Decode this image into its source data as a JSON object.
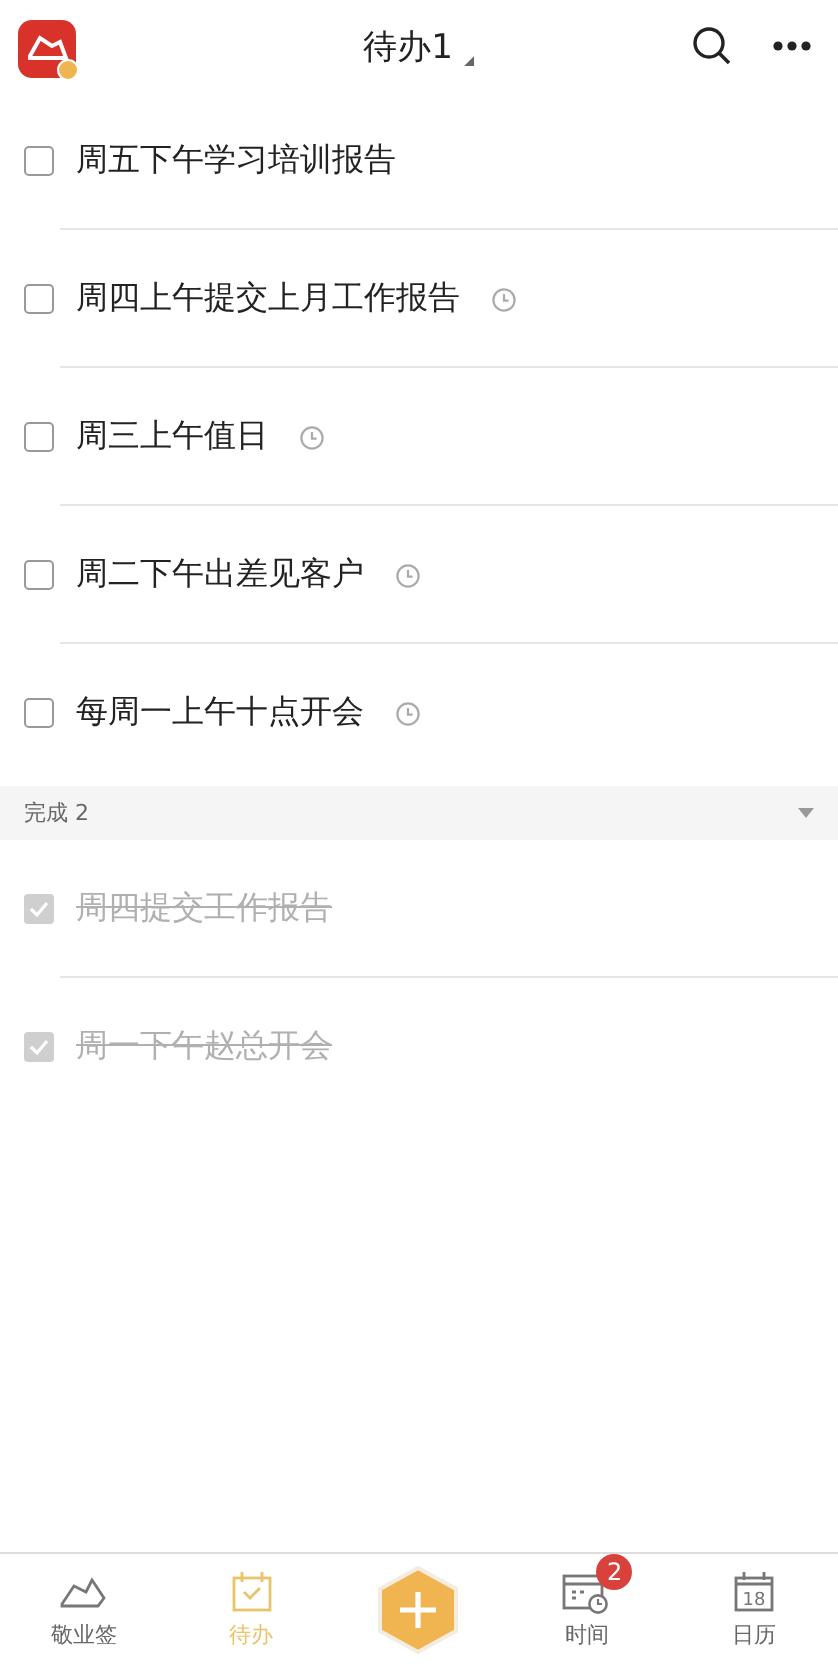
{
  "header": {
    "title": "待办1"
  },
  "tasks": [
    {
      "text": "周五下午学习培训报告",
      "done": false,
      "reminder": false
    },
    {
      "text": "周四上午提交上月工作报告",
      "done": false,
      "reminder": true
    },
    {
      "text": "周三上午值日",
      "done": false,
      "reminder": true
    },
    {
      "text": "周二下午出差见客户",
      "done": false,
      "reminder": true
    },
    {
      "text": "每周一上午十点开会",
      "done": false,
      "reminder": true
    }
  ],
  "completed_section": {
    "label": "完成",
    "count": "2",
    "expanded": true
  },
  "completed": [
    {
      "text": "周四提交工作报告",
      "done": true,
      "reminder": false
    },
    {
      "text": "周一下午赵总开会",
      "done": true,
      "reminder": false
    }
  ],
  "tabs": [
    {
      "kind": "notes",
      "label": "敬业签",
      "selected": false
    },
    {
      "kind": "todo",
      "label": "待办",
      "selected": true
    },
    {
      "kind": "add",
      "selected": false
    },
    {
      "kind": "time",
      "label": "时间",
      "selected": false,
      "badge": "2"
    },
    {
      "kind": "calendar",
      "label": "日历",
      "selected": false,
      "icon_text": "18"
    }
  ]
}
